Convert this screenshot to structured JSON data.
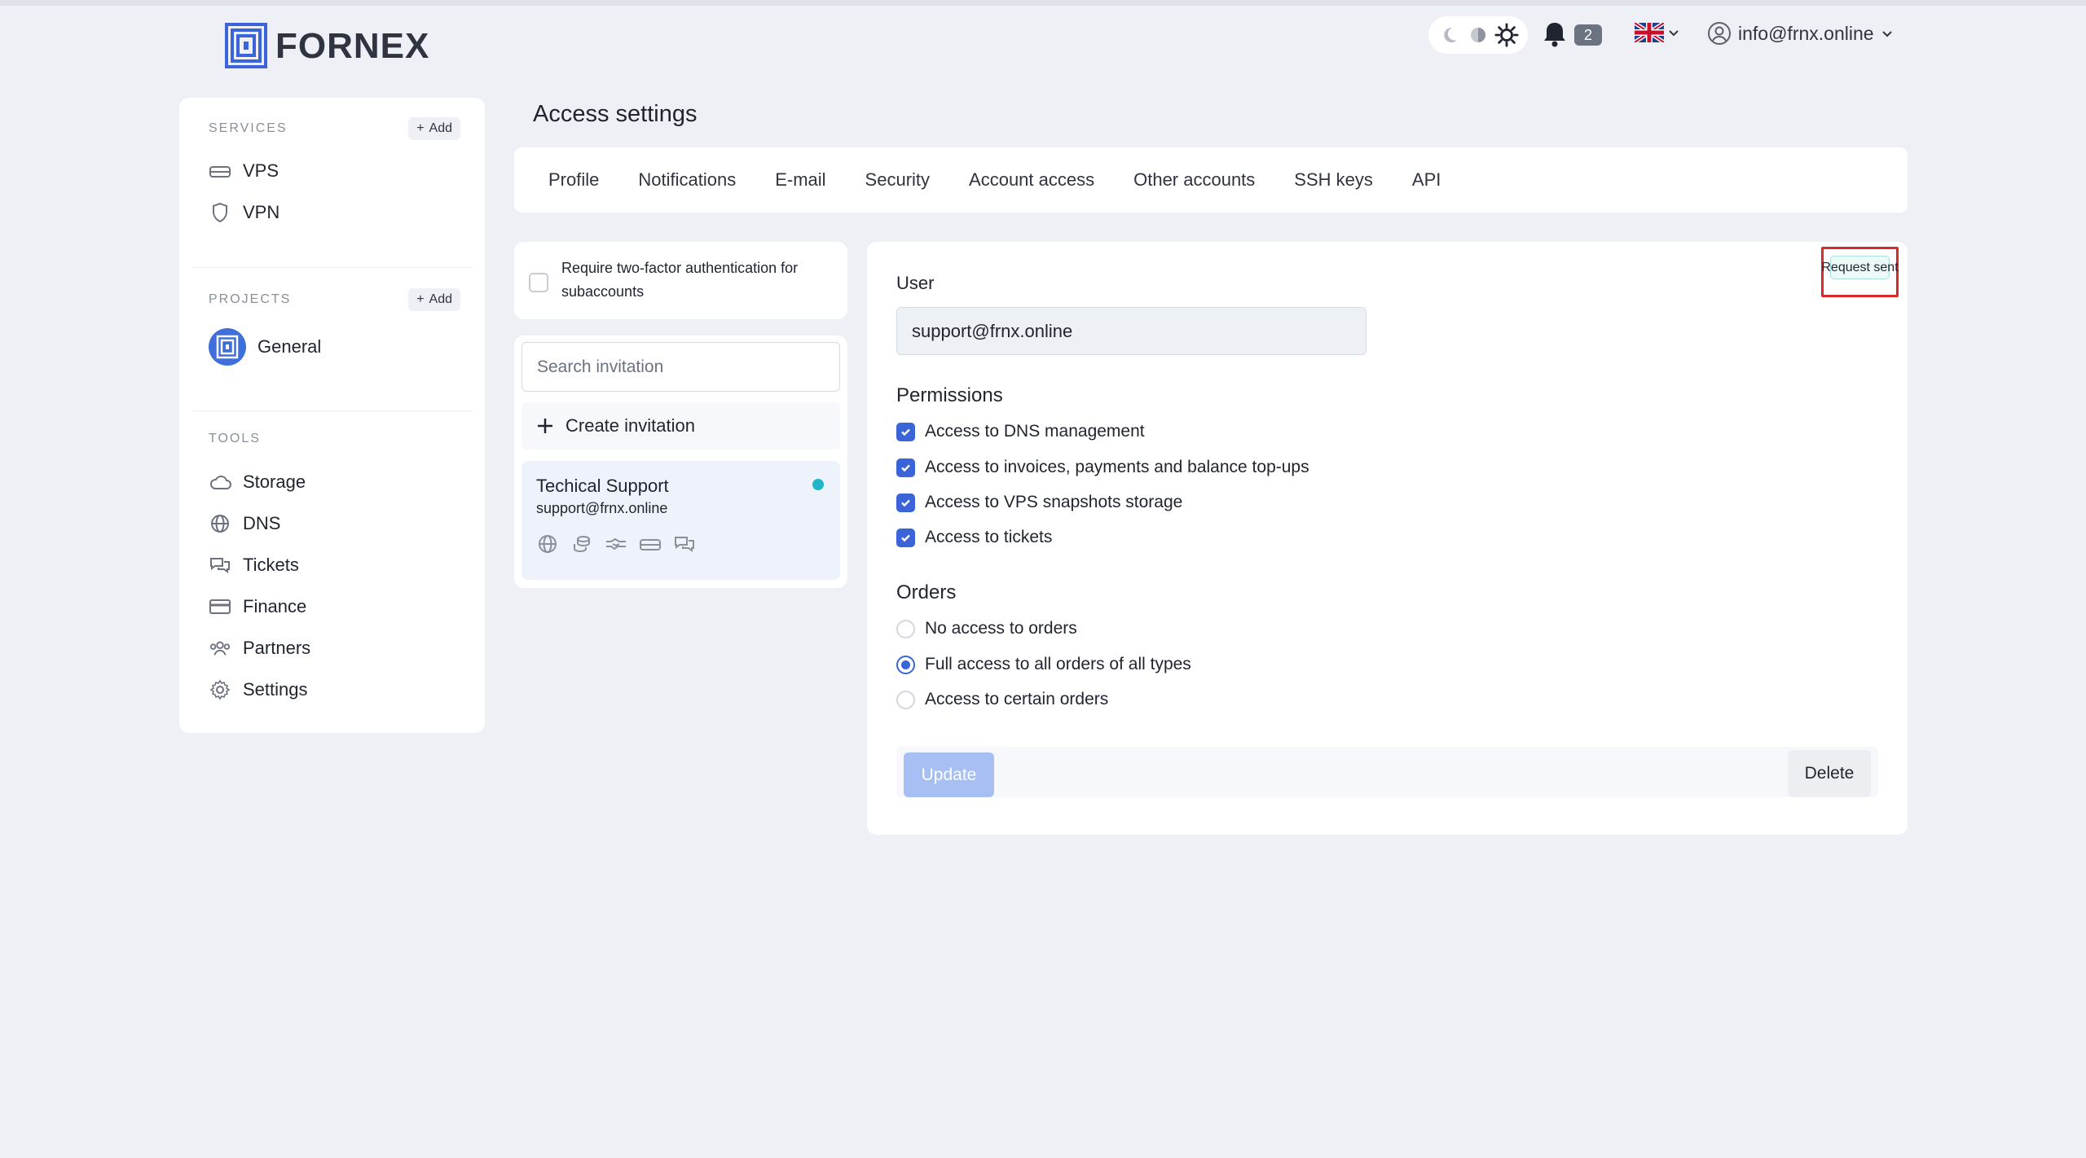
{
  "brand": {
    "name": "FORNEX"
  },
  "header": {
    "theme_icons": [
      "moon-icon",
      "half-circle-icon",
      "sun-icon"
    ],
    "notifications_count": "2",
    "language": "flag-uk-icon",
    "account_email": "info@frnx.online"
  },
  "sidebar": {
    "services_title": "SERVICES",
    "services_add": "Add",
    "services": [
      {
        "label": "VPS",
        "icon": "server-icon"
      },
      {
        "label": "VPN",
        "icon": "shield-icon"
      }
    ],
    "projects_title": "PROJECTS",
    "projects_add": "Add",
    "projects": [
      {
        "label": "General",
        "icon": "project-icon"
      }
    ],
    "tools_title": "TOOLS",
    "tools": [
      {
        "label": "Storage",
        "icon": "cloud-icon"
      },
      {
        "label": "DNS",
        "icon": "globe-icon"
      },
      {
        "label": "Tickets",
        "icon": "chat-icon"
      },
      {
        "label": "Finance",
        "icon": "card-icon"
      },
      {
        "label": "Partners",
        "icon": "users-icon"
      },
      {
        "label": "Settings",
        "icon": "gear-icon"
      }
    ]
  },
  "main": {
    "title": "Access settings",
    "tabs": [
      "Profile",
      "Notifications",
      "E-mail",
      "Security",
      "Account access",
      "Other accounts",
      "SSH keys",
      "API"
    ],
    "twofa_label": "Require two-factor authentication for subaccounts",
    "search_placeholder": "Search invitation",
    "create_invitation": "Create invitation",
    "invitation": {
      "name": "Techical Support",
      "email": "support@frnx.online"
    },
    "detail": {
      "status_badge": "Request sent",
      "user_label": "User",
      "user_value": "support@frnx.online",
      "permissions_title": "Permissions",
      "permissions": [
        "Access to DNS management",
        "Access to invoices, payments and balance top-ups",
        "Access to VPS snapshots storage",
        "Access to tickets"
      ],
      "orders_title": "Orders",
      "orders": [
        "No access to orders",
        "Full access to all orders of all types",
        "Access to certain orders"
      ],
      "orders_selected": "Full access to all orders of all types",
      "update_label": "Update",
      "delete_label": "Delete"
    }
  },
  "colors": {
    "accent": "#3a64d8",
    "highlight_box": "#d62b2b",
    "status_dot": "#1fb6c9"
  }
}
